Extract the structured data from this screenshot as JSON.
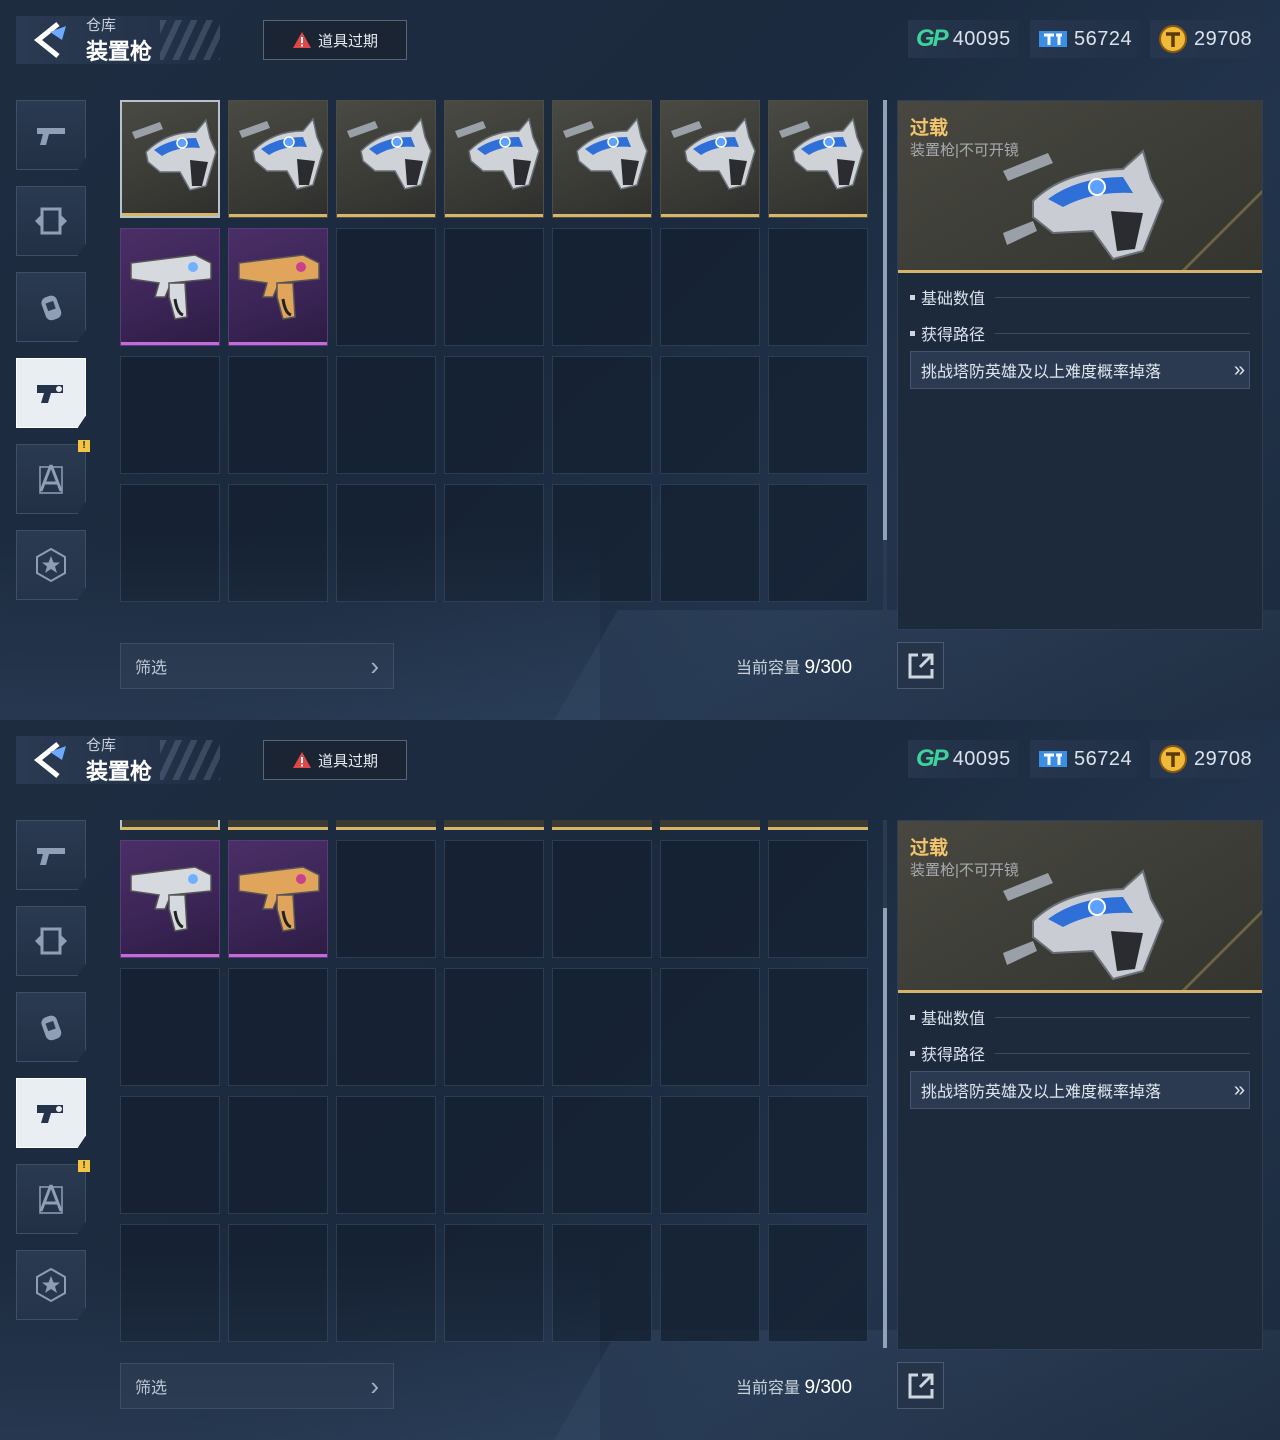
{
  "header": {
    "breadcrumb": "仓库",
    "title": "装置枪",
    "expired_label": "道具过期"
  },
  "currencies": [
    {
      "icon": "gp-icon",
      "value": "40095"
    },
    {
      "icon": "t-ticket-icon",
      "value": "56724"
    },
    {
      "icon": "gold-coin-icon",
      "value": "29708"
    }
  ],
  "sidebar": {
    "tabs": [
      {
        "icon": "pistol-icon"
      },
      {
        "icon": "card-frame-icon"
      },
      {
        "icon": "grenade-icon"
      },
      {
        "icon": "device-gun-icon",
        "active": true
      },
      {
        "icon": "compass-tool-icon",
        "notice": "!"
      },
      {
        "icon": "star-badge-icon"
      }
    ]
  },
  "inventory": {
    "items": [
      {
        "rarity": "gold",
        "name": "过载"
      },
      {
        "rarity": "gold",
        "name": "过载"
      },
      {
        "rarity": "gold",
        "name": "过载"
      },
      {
        "rarity": "gold",
        "name": "过载"
      },
      {
        "rarity": "gold",
        "name": "过载"
      },
      {
        "rarity": "gold",
        "name": "过载"
      },
      {
        "rarity": "gold",
        "name": "过载"
      },
      {
        "rarity": "purple",
        "variant": "silver"
      },
      {
        "rarity": "purple",
        "variant": "orange"
      }
    ],
    "filter_label": "筛选",
    "capacity_label": "当前容量",
    "capacity_current": "9",
    "capacity_total": "/300"
  },
  "detail": {
    "name": "过载",
    "type": "装置枪|不可开镜",
    "section_stats": "基础数值",
    "section_source": "获得路径",
    "source_route": "挑战塔防英雄及以上难度概率掉落"
  },
  "colors": {
    "gold_rarity": "#d9b56a",
    "purple_rarity": "#c46bd8",
    "title_gold": "#f3c56c",
    "gp_green": "#3fd39c"
  }
}
